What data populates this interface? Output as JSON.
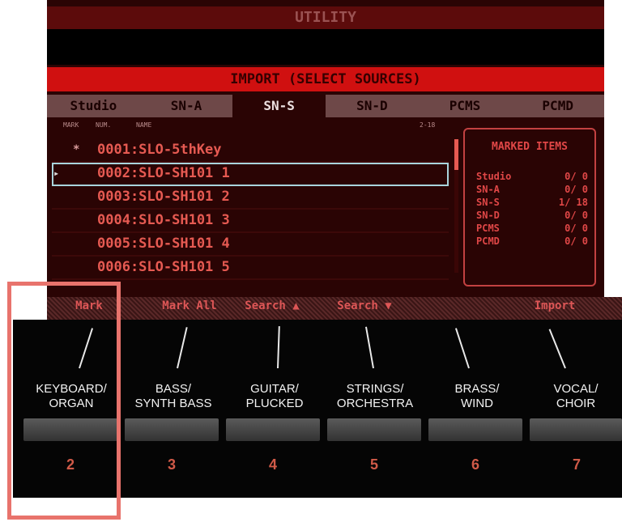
{
  "screen": {
    "title": "UTILITY",
    "subtitle": "IMPORT (SELECT SOURCES)",
    "tabs": [
      {
        "label": "Studio",
        "active": false
      },
      {
        "label": "SN-A",
        "active": false
      },
      {
        "label": "SN-S",
        "active": true
      },
      {
        "label": "SN-D",
        "active": false
      },
      {
        "label": "PCMS",
        "active": false
      },
      {
        "label": "PCMD",
        "active": false
      }
    ],
    "list_header": {
      "mark": "MARK",
      "num": "NUM.",
      "name": "NAME",
      "range": "2-18"
    },
    "items": [
      {
        "mark": "*",
        "name": "0001:SLO-5thKey",
        "selected": false
      },
      {
        "mark": "",
        "name": "0002:SLO-SH101 1",
        "selected": true
      },
      {
        "mark": "",
        "name": "0003:SLO-SH101 2",
        "selected": false
      },
      {
        "mark": "",
        "name": "0004:SLO-SH101 3",
        "selected": false
      },
      {
        "mark": "",
        "name": "0005:SLO-SH101 4",
        "selected": false
      },
      {
        "mark": "",
        "name": "0006:SLO-SH101 5",
        "selected": false
      }
    ],
    "marked_items": {
      "title": "MARKED ITEMS",
      "rows": [
        {
          "label": "Studio",
          "value": "0/ 0"
        },
        {
          "label": "SN-A",
          "value": "0/ 0"
        },
        {
          "label": "SN-S",
          "value": "1/ 18"
        },
        {
          "label": "SN-D",
          "value": "0/ 0"
        },
        {
          "label": "PCMS",
          "value": "0/ 0"
        },
        {
          "label": "PCMD",
          "value": "0/ 0"
        }
      ]
    },
    "function_labels": [
      "Mark",
      "Mark All",
      "Search ▲",
      "Search ▼",
      "",
      "Import"
    ]
  },
  "panel": {
    "buttons": [
      {
        "category": "KEYBOARD/ ORGAN",
        "line1": "KEYBOARD/",
        "line2": "ORGAN",
        "number": "2"
      },
      {
        "category": "BASS/ SYNTH BASS",
        "line1": "BASS/",
        "line2": "SYNTH BASS",
        "number": "3"
      },
      {
        "category": "GUITAR/ PLUCKED",
        "line1": "GUITAR/",
        "line2": "PLUCKED",
        "number": "4"
      },
      {
        "category": "STRINGS/ ORCHESTRA",
        "line1": "STRINGS/",
        "line2": "ORCHESTRA",
        "number": "5"
      },
      {
        "category": "BRASS/ WIND",
        "line1": "BRASS/",
        "line2": "WIND",
        "number": "6"
      },
      {
        "category": "VOCAL/ CHOIR",
        "line1": "VOCAL/",
        "line2": "CHOIR",
        "number": "7"
      }
    ]
  },
  "colors": {
    "screen_bg": "#2a0404",
    "accent_red": "#d01010",
    "list_text": "#e65a52",
    "highlight": "#e8736c"
  }
}
